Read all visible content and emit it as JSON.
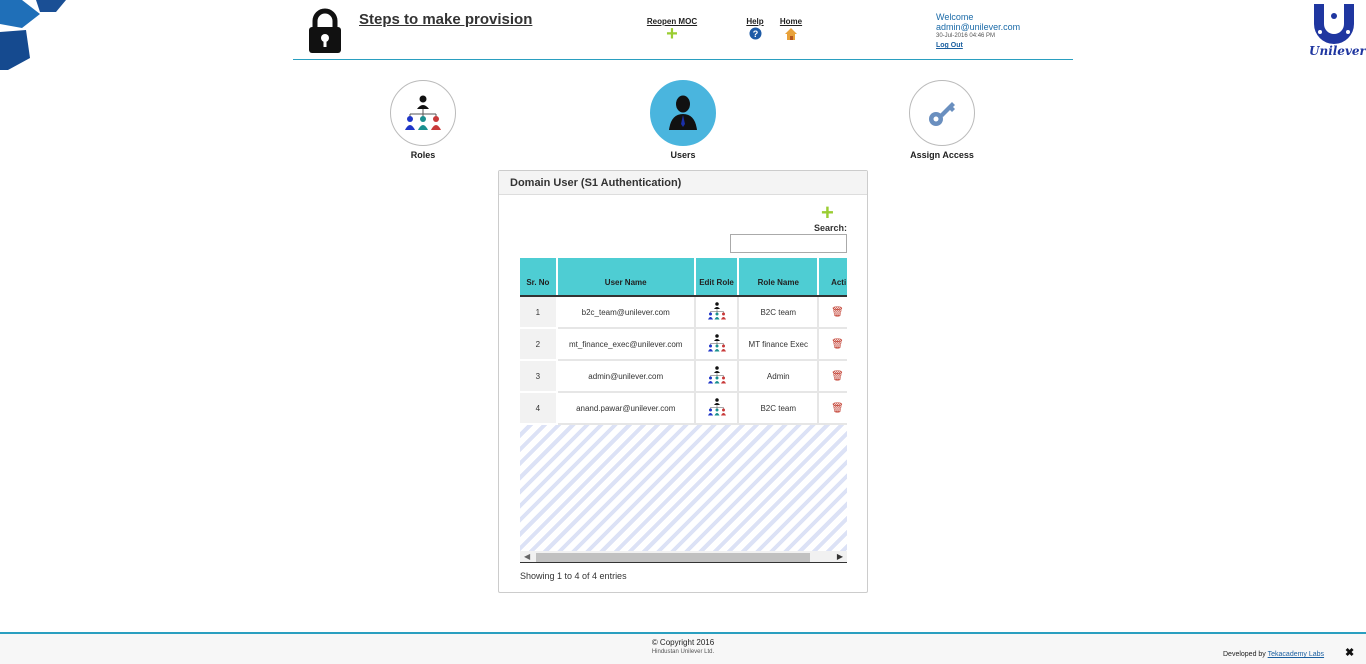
{
  "header": {
    "title": "Steps to make provision",
    "reopen_label": "Reopen MOC",
    "help_label": "Help",
    "home_label": "Home",
    "welcome": "Welcome",
    "user_email": "admin@unilever.com",
    "datetime": "30-Jul-2016 04:46 PM",
    "logout_label": "Log Out",
    "brand": "Unilever"
  },
  "steps": [
    {
      "label": "Roles",
      "icon": "org-chart-icon",
      "active": false
    },
    {
      "label": "Users",
      "icon": "user-icon",
      "active": true
    },
    {
      "label": "Assign Access",
      "icon": "key-icon",
      "active": false
    }
  ],
  "panel": {
    "title": "Domain User (S1 Authentication)",
    "add_label": "+",
    "search_label": "Search:",
    "search_value": "",
    "columns": [
      "Sr. No",
      "User Name",
      "Edit Role",
      "Role Name",
      "Acti"
    ],
    "rows": [
      {
        "no": "1",
        "user": "b2c_team@unilever.com",
        "role": "B2C team"
      },
      {
        "no": "2",
        "user": "mt_finance_exec@unilever.com",
        "role": "MT finance Exec"
      },
      {
        "no": "3",
        "user": "admin@unilever.com",
        "role": "Admin"
      },
      {
        "no": "4",
        "user": "anand.pawar@unilever.com",
        "role": "B2C team"
      }
    ],
    "info": "Showing 1 to 4 of 4 entries"
  },
  "footer": {
    "copyright": "© Copyright 2016",
    "company": "Hindustan Unilever Ltd.",
    "developed_by": "Developed by",
    "developer": "Tekacademy Labs",
    "close_glyph": "✖"
  },
  "colors": {
    "accent": "#2a9fc0",
    "table_header": "#4ecdd3",
    "active_step": "#4ab5de",
    "plus": "#9acd32"
  }
}
